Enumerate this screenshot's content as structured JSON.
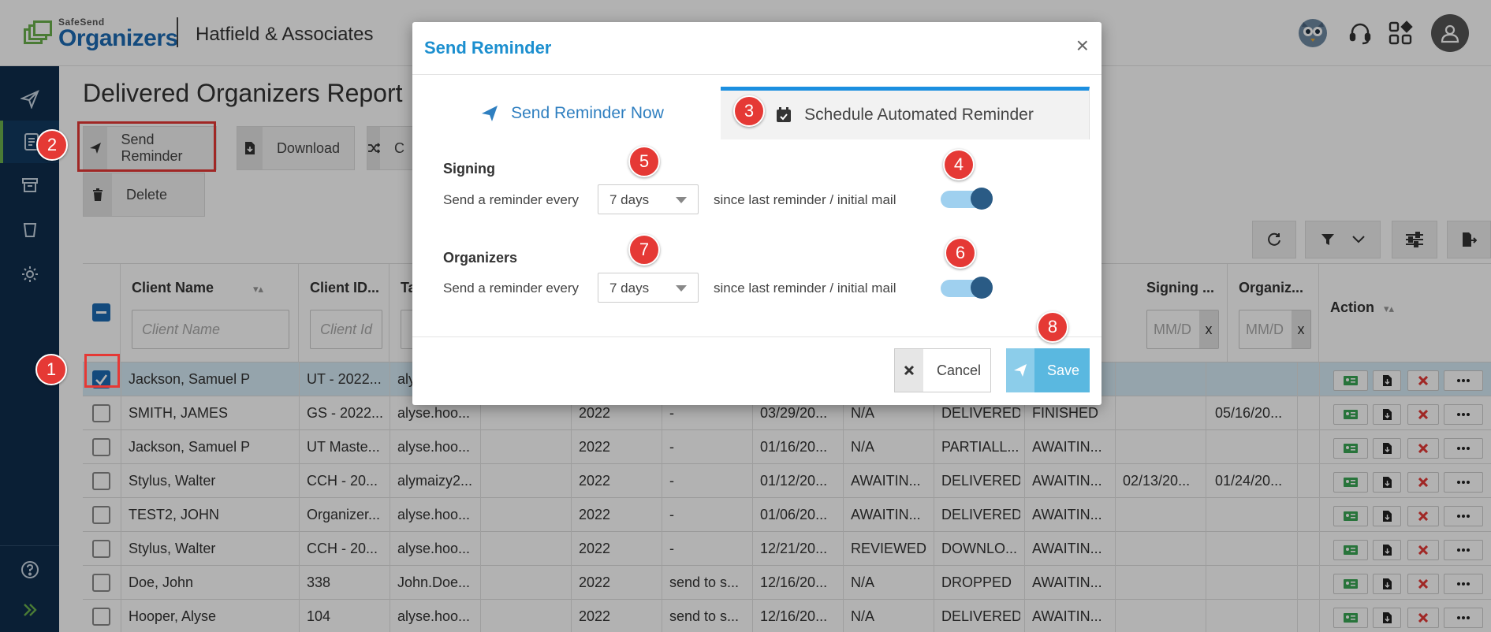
{
  "header": {
    "logo_small": "SafeSend",
    "logo_big": "Organizers",
    "company": "Hatfield & Associates"
  },
  "page": {
    "title": "Delivered Organizers Report"
  },
  "toolbar": {
    "send_reminder": "Send Reminder",
    "download": "Download",
    "c_label": "C",
    "delete": "Delete"
  },
  "table": {
    "columns": [
      {
        "label": "Client Name",
        "placeholder": "Client Name"
      },
      {
        "label": "Client ID...",
        "placeholder": "Client Id"
      },
      {
        "label": "Ta",
        "placeholder": ""
      },
      {
        "label": "Signing ...",
        "placeholder": "MM/D"
      },
      {
        "label": "Organiz...",
        "placeholder": "MM/D"
      },
      {
        "label": "Action",
        "placeholder": ""
      }
    ],
    "clear_x": "x",
    "rows": [
      {
        "checked": true,
        "name": "Jackson, Samuel P",
        "id": "UT - 2022...",
        "email": "aly",
        "year": "",
        "c5": "",
        "c6": "",
        "c7": "",
        "c8": "",
        "c9": "",
        "c10": "",
        "c11": ""
      },
      {
        "checked": false,
        "name": "SMITH, JAMES",
        "id": "GS - 2022...",
        "email": "alyse.hoo...",
        "year": "2022",
        "c5": "-",
        "c6": "03/29/20...",
        "c7": "N/A",
        "c8": "DELIVERED",
        "c9": "FINISHED",
        "c10": "",
        "c11": "05/16/20..."
      },
      {
        "checked": false,
        "name": "Jackson, Samuel P",
        "id": "UT Maste...",
        "email": "alyse.hoo...",
        "year": "2022",
        "c5": "-",
        "c6": "01/16/20...",
        "c7": "N/A",
        "c8": "PARTIALL...",
        "c9": "AWAITIN...",
        "c10": "",
        "c11": ""
      },
      {
        "checked": false,
        "name": "Stylus, Walter",
        "id": "CCH - 20...",
        "email": "alymaizy2...",
        "year": "2022",
        "c5": "-",
        "c6": "01/12/20...",
        "c7": "AWAITIN...",
        "c8": "DELIVERED",
        "c9": "AWAITIN...",
        "c10": "02/13/20...",
        "c11": "01/24/20..."
      },
      {
        "checked": false,
        "name": "TEST2, JOHN",
        "id": "Organizer...",
        "email": "alyse.hoo...",
        "year": "2022",
        "c5": "-",
        "c6": "01/06/20...",
        "c7": "AWAITIN...",
        "c8": "DELIVERED",
        "c9": "AWAITIN...",
        "c10": "",
        "c11": ""
      },
      {
        "checked": false,
        "name": "Stylus, Walter",
        "id": "CCH - 20...",
        "email": "alyse.hoo...",
        "year": "2022",
        "c5": "-",
        "c6": "12/21/20...",
        "c7": "REVIEWED",
        "c8": "DOWNLO...",
        "c9": "AWAITIN...",
        "c10": "",
        "c11": ""
      },
      {
        "checked": false,
        "name": "Doe, John",
        "id": "338",
        "email": "John.Doe...",
        "year": "2022",
        "c5": "send to s...",
        "c6": "12/16/20...",
        "c7": "N/A",
        "c8": "DROPPED",
        "c9": "AWAITIN...",
        "c10": "",
        "c11": ""
      },
      {
        "checked": false,
        "name": "Hooper, Alyse",
        "id": "104",
        "email": "alyse.hoo...",
        "year": "2022",
        "c5": "send to s...",
        "c6": "12/16/20...",
        "c7": "N/A",
        "c8": "DELIVERED",
        "c9": "AWAITIN...",
        "c10": "",
        "c11": ""
      }
    ]
  },
  "modal": {
    "title": "Send Reminder",
    "close": "×",
    "tab_now": "Send Reminder Now",
    "tab_schedule": "Schedule Automated Reminder",
    "signing": {
      "title": "Signing",
      "prefix": "Send a reminder every",
      "value": "7 days",
      "suffix": "since last reminder / initial mail",
      "enabled": true
    },
    "organizers": {
      "title": "Organizers",
      "prefix": "Send a reminder every",
      "value": "7 days",
      "suffix": "since last reminder / initial mail",
      "enabled": true
    },
    "cancel": "Cancel",
    "save": "Save"
  },
  "markers": [
    "1",
    "2",
    "3",
    "4",
    "5",
    "6",
    "7",
    "8"
  ],
  "colors": {
    "accent": "#1c8fcf",
    "marker": "#e53935",
    "sidebar": "#0f2d4d",
    "brand_green": "#6ab04c"
  }
}
